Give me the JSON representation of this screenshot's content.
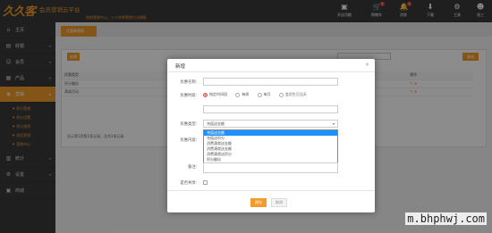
{
  "app": {
    "logo": "久久客",
    "title": "会员营销云平台",
    "tagline": "快到营销中心，二十余种营销方式模板"
  },
  "topnav": [
    {
      "label": "开店功能",
      "icon": "shop-icon"
    },
    {
      "label": "购物车",
      "icon": "cart-icon"
    },
    {
      "label": "消息",
      "icon": "bell-icon"
    },
    {
      "label": "下载",
      "icon": "download-icon"
    },
    {
      "label": "工具",
      "icon": "tools-icon"
    },
    {
      "label": "张三",
      "icon": "avatar-icon"
    }
  ],
  "sidebar": {
    "items": [
      {
        "label": "主页",
        "icon": "home-icon"
      },
      {
        "label": "收银",
        "icon": "cashier-icon"
      },
      {
        "label": "会员",
        "icon": "member-icon"
      },
      {
        "label": "产品",
        "icon": "product-icon"
      },
      {
        "label": "营销",
        "icon": "marketing-icon",
        "active": true
      },
      {
        "label": "统计",
        "icon": "stats-icon"
      },
      {
        "label": "设置",
        "icon": "settings-icon"
      },
      {
        "label": "商城",
        "icon": "mall-icon"
      }
    ],
    "subitems": [
      "积分营销",
      "积分设置",
      "积分规则",
      "短信营销",
      "营销中心"
    ]
  },
  "main": {
    "tab": "优惠券管理",
    "add_button": "新增",
    "search_placeholder": "请输入",
    "search_button": "查询",
    "table": {
      "headers": [
        "优惠类型",
        "优惠名称",
        "",
        "",
        "",
        "",
        "",
        "操作"
      ],
      "rows": [
        [
          "积分翻倍",
          "积分翻2倍"
        ],
        [
          "满减活动",
          "满100减10"
        ]
      ]
    },
    "paging": "显示第1到第2条记录，总共2条记录"
  },
  "modal": {
    "title": "新增",
    "close": "×",
    "fields": {
      "name_label": "优惠名称：",
      "name_value": "",
      "time_label": "优惠时段：",
      "time_options": [
        "指定时间段",
        "每周",
        "每月",
        "会员生日当天"
      ],
      "type_label": "优惠类型：",
      "type_selected": "充值送金额",
      "type_options": [
        "充值送金额",
        "充值送积分",
        "消费满就送金额",
        "消费满就送金额",
        "消费满就送积分",
        "积分翻倍"
      ],
      "content_label": "优惠内容：",
      "remark_label": "备注：",
      "share_label": "是否共享："
    },
    "save": "保存",
    "cancel": "取消"
  },
  "colors": {
    "accent": "#f39b2c",
    "dark": "#3a3a3a",
    "highlight": "#1e90ff",
    "alert": "#e9433b"
  },
  "watermark": "m.bhphwj.com"
}
